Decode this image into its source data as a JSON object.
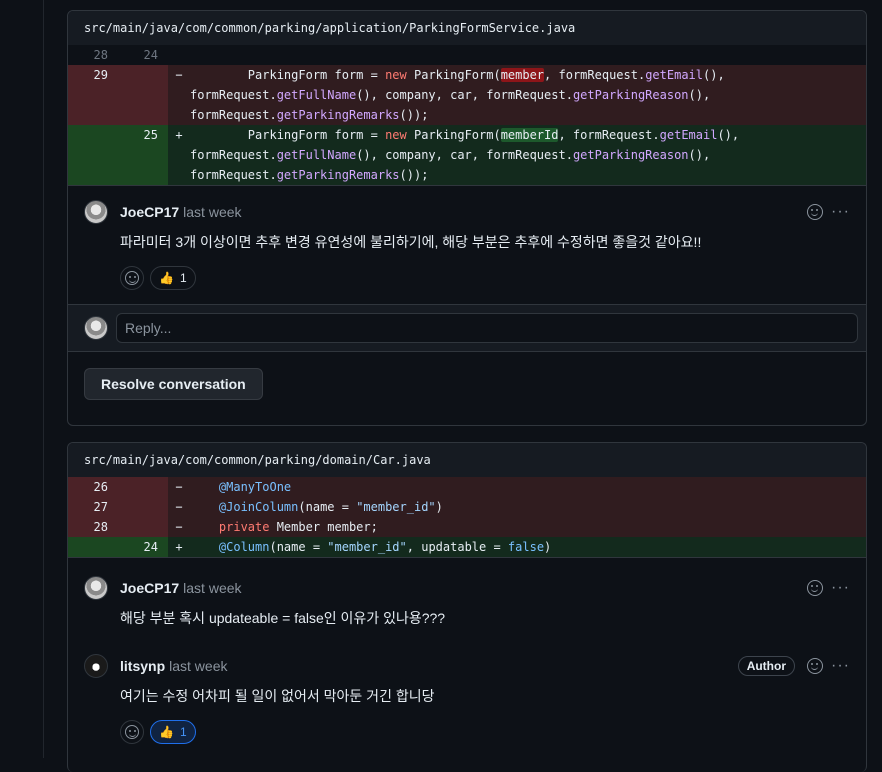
{
  "thread1": {
    "file_path": "src/main/java/com/common/parking/application/ParkingFormService.java",
    "context_old": "28",
    "context_new": "24",
    "del_line": "29",
    "add_line": "25",
    "del_sign": "−",
    "add_sign": "+",
    "comment": {
      "author": "JoeCP17",
      "time": "last week",
      "body": "파라미터 3개 이상이면 추후 변경 유연성에 불리하기에, 해당 부분은 추후에 수정하면 좋을것 같아요!!",
      "reaction_emoji": "👍",
      "reaction_count": "1"
    },
    "reply_placeholder": "Reply...",
    "resolve_label": "Resolve conversation"
  },
  "thread2": {
    "file_path": "src/main/java/com/common/parking/domain/Car.java",
    "del_lines": [
      "26",
      "27",
      "28"
    ],
    "add_line": "24",
    "del_sign": "−",
    "add_sign": "+",
    "comment1": {
      "author": "JoeCP17",
      "time": "last week",
      "body": "해당 부분 혹시 updateable = false인 이유가 있나용???"
    },
    "comment2": {
      "author": "litsynp",
      "time": "last week",
      "badge": "Author",
      "body": "여기는 수정 어차피 될 일이 없어서 막아둔 거긴 합니당",
      "reaction_emoji": "👍",
      "reaction_count": "1"
    }
  },
  "icons": {
    "more": "···"
  }
}
